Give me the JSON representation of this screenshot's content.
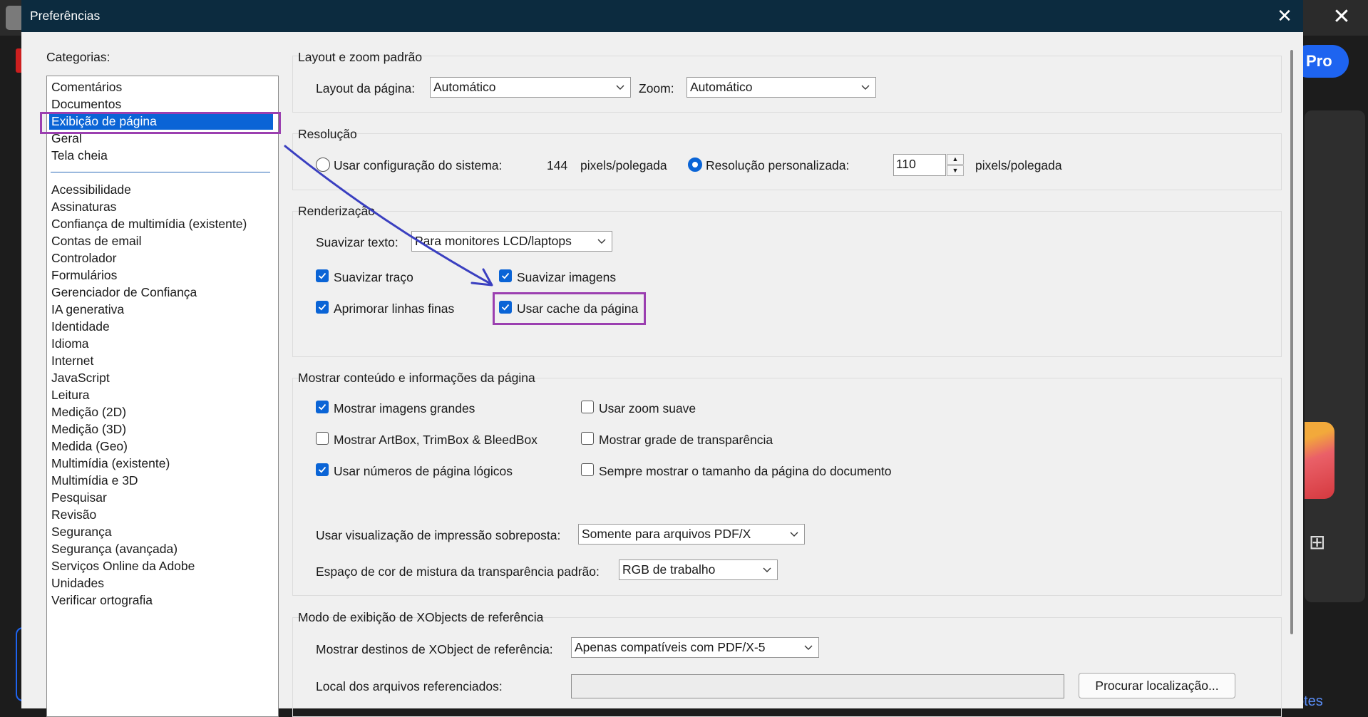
{
  "window": {
    "title": "Preferências",
    "close_icon": "close-icon"
  },
  "background": {
    "pro_button": "Pro",
    "link_fragment": "otes",
    "close_icon": "✕",
    "grid_icon": "⊞"
  },
  "categories": {
    "label": "Categorias:",
    "top_items": [
      "Comentários",
      "Documentos",
      "Exibição de página",
      "Geral",
      "Tela cheia"
    ],
    "selected": "Exibição de página",
    "items": [
      "Acessibilidade",
      "Assinaturas",
      "Confiança de multimídia (existente)",
      "Contas de email",
      "Controlador",
      "Formulários",
      "Gerenciador de Confiança",
      "IA generativa",
      "Identidade",
      "Idioma",
      "Internet",
      "JavaScript",
      "Leitura",
      "Medição (2D)",
      "Medição (3D)",
      "Medida (Geo)",
      "Multimídia (existente)",
      "Multimídia e 3D",
      "Pesquisar",
      "Revisão",
      "Segurança",
      "Segurança (avançada)",
      "Serviços Online da Adobe",
      "Unidades",
      "Verificar ortografia"
    ]
  },
  "layout_zoom": {
    "title": "Layout e zoom padrão",
    "page_layout_label": "Layout da página:",
    "page_layout_value": "Automático",
    "zoom_label": "Zoom:",
    "zoom_value": "Automático"
  },
  "resolution": {
    "title": "Resolução",
    "system_option_label": "Usar configuração do sistema:",
    "system_value": "144",
    "system_unit": "pixels/polegada",
    "system_selected": false,
    "custom_option_label": "Resolução personalizada:",
    "custom_selected": true,
    "custom_value": "110",
    "custom_unit": "pixels/polegada"
  },
  "rendering": {
    "title": "Renderização",
    "smooth_text_label": "Suavizar texto:",
    "smooth_text_value": "Para monitores LCD/laptops",
    "checkboxes": [
      {
        "label": "Suavizar traço",
        "checked": true
      },
      {
        "label": "Suavizar imagens",
        "checked": true
      },
      {
        "label": "Aprimorar linhas finas",
        "checked": true
      },
      {
        "label": "Usar cache da página",
        "checked": true
      }
    ]
  },
  "page_content": {
    "title": "Mostrar conteúdo e informações da página",
    "checkboxes": [
      {
        "label": "Mostrar imagens grandes",
        "checked": true
      },
      {
        "label": "Usar zoom suave",
        "checked": false
      },
      {
        "label": "Mostrar ArtBox, TrimBox & BleedBox",
        "checked": false
      },
      {
        "label": "Mostrar grade de transparência",
        "checked": false
      },
      {
        "label": "Usar números de página lógicos",
        "checked": true
      },
      {
        "label": "Sempre mostrar o tamanho da página do documento",
        "checked": false
      }
    ],
    "overprint_label": "Usar visualização de impressão sobreposta:",
    "overprint_value": "Somente para arquivos PDF/X",
    "blend_space_label": "Espaço de cor de mistura da transparência padrão:",
    "blend_space_value": "RGB de trabalho"
  },
  "xobjects": {
    "title": "Modo de exibição de XObjects de referência",
    "targets_label": "Mostrar destinos de XObject de referência:",
    "targets_value": "Apenas compatíveis com PDF/X-5",
    "files_location_label": "Local dos arquivos referenciados:",
    "files_location_value": "",
    "browse_button": "Procurar localização..."
  },
  "colors": {
    "titlebar": "#0c2b3f",
    "selection": "#0a64d6",
    "highlight_box": "#9b3fb0",
    "annotation_arrow": "#3a3fc0"
  }
}
